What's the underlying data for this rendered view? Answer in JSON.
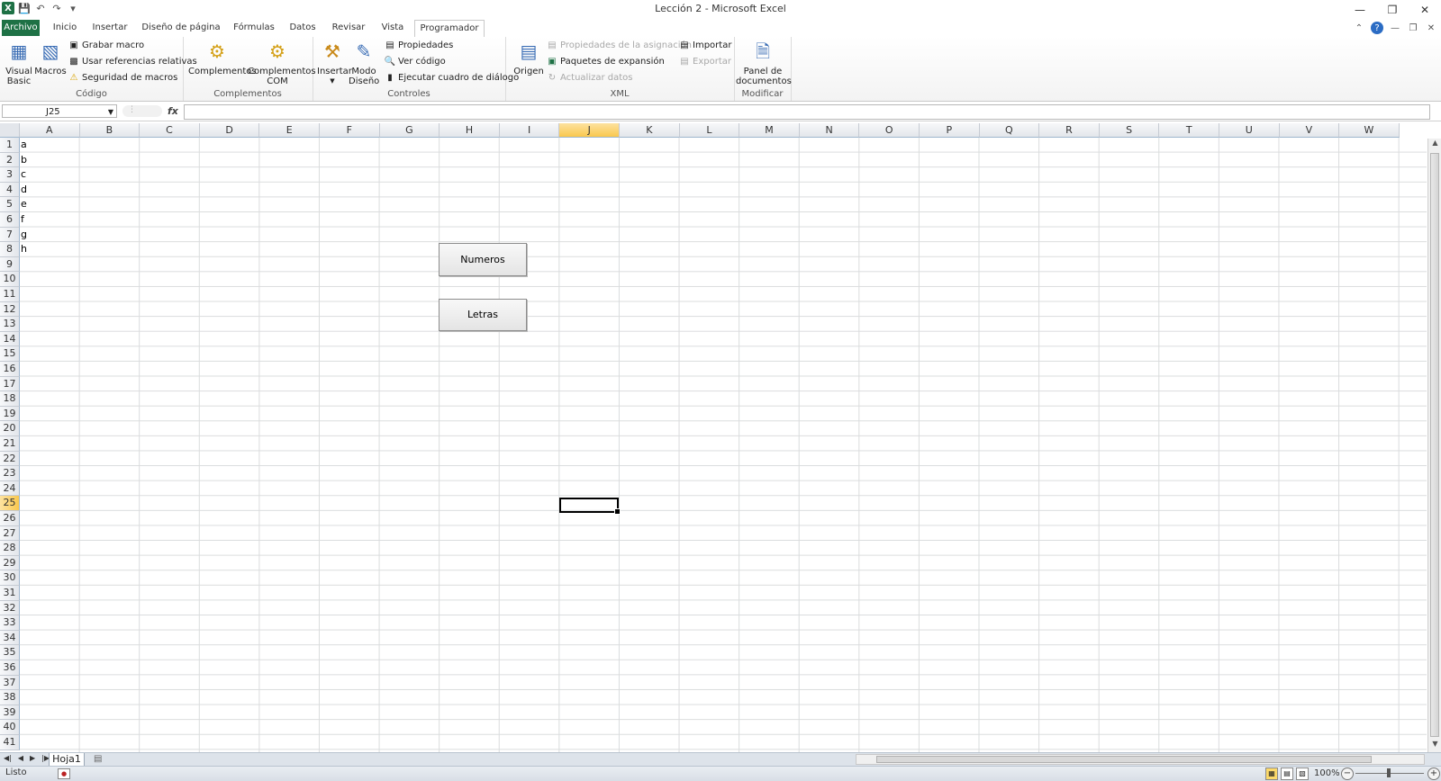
{
  "window": {
    "title": "Lección 2  -  Microsoft Excel",
    "app_icon": "X"
  },
  "tabs": [
    {
      "label": "Archivo"
    },
    {
      "label": "Inicio"
    },
    {
      "label": "Insertar"
    },
    {
      "label": "Diseño de página"
    },
    {
      "label": "Fórmulas"
    },
    {
      "label": "Datos"
    },
    {
      "label": "Revisar"
    },
    {
      "label": "Vista"
    },
    {
      "label": "Programador"
    }
  ],
  "ribbon": {
    "codigo": {
      "label": "Código",
      "visual_basic": "Visual Basic",
      "visual_basic_l1": "Visual",
      "visual_basic_l2": "Basic",
      "macros": "Macros",
      "grabar_macro": "Grabar macro",
      "usar_referencias": "Usar referencias relativas",
      "seguridad": "Seguridad de macros"
    },
    "complementos": {
      "label": "Complementos",
      "complementos": "Complementos",
      "com_l1": "Complementos",
      "com_l2": "COM"
    },
    "controles": {
      "label": "Controles",
      "insertar": "Insertar",
      "modo_l1": "Modo",
      "modo_l2": "Diseño",
      "propiedades": "Propiedades",
      "ver_codigo": "Ver código",
      "ejecutar": "Ejecutar cuadro de diálogo"
    },
    "xml": {
      "label": "XML",
      "origen": "Origen",
      "propiedades_asignacion": "Propiedades de la asignación",
      "paquetes": "Paquetes de expansión",
      "actualizar": "Actualizar datos",
      "importar": "Importar",
      "exportar": "Exportar"
    },
    "modificar": {
      "label": "Modificar",
      "panel_l1": "Panel de",
      "panel_l2": "documentos"
    }
  },
  "formula_bar": {
    "name_box": "J25",
    "fx": "fx",
    "formula": ""
  },
  "sheet": {
    "columns": [
      "A",
      "B",
      "C",
      "D",
      "E",
      "F",
      "G",
      "H",
      "I",
      "J",
      "K",
      "L",
      "M",
      "N",
      "O",
      "P",
      "Q",
      "R",
      "S",
      "T",
      "U",
      "V",
      "W"
    ],
    "selected_column": "J",
    "selected_row": 25,
    "row_count": 41,
    "cells_A": [
      "a",
      "b",
      "c",
      "d",
      "e",
      "f",
      "g",
      "h"
    ],
    "buttons": {
      "numeros": "Numeros",
      "letras": "Letras"
    }
  },
  "sheet_tabs": [
    {
      "label": "Hoja1"
    }
  ],
  "status": {
    "ready": "Listo",
    "zoom": "100%"
  }
}
